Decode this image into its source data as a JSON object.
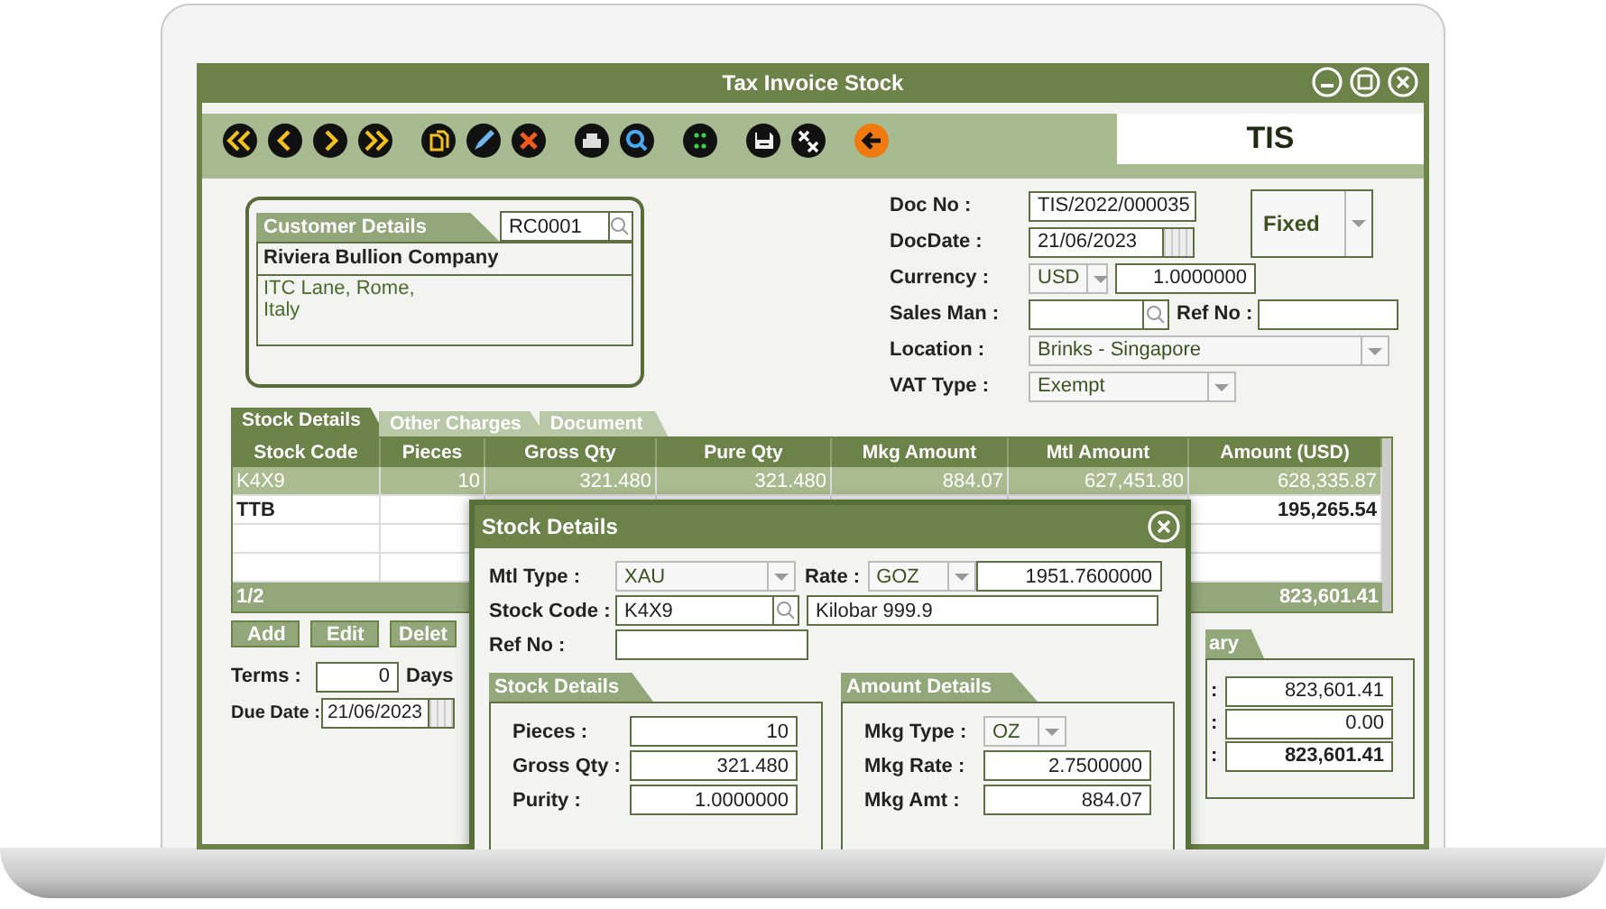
{
  "window": {
    "title": "Tax Invoice Stock"
  },
  "toolbar": {
    "code": "TIS"
  },
  "customer": {
    "label": "Customer Details",
    "code": "RC0001",
    "name": "Riviera Bullion Company",
    "address_lines": [
      "ITC Lane, Rome,",
      "Italy"
    ]
  },
  "doc": {
    "doc_no_label": "Doc No :",
    "doc_no": "TIS/2022/000035",
    "date_label": "DocDate :",
    "date": "21/06/2023",
    "rate_mode": "Fixed",
    "currency_label": "Currency :",
    "currency": "USD",
    "exchange_rate": "1.0000000",
    "salesman_label": "Sales Man :",
    "ref_no_label": "Ref No :",
    "location_label": "Location :",
    "location": "Brinks - Singapore",
    "vat_label": "VAT Type :",
    "vat_type": "Exempt"
  },
  "tabs": [
    {
      "label": "Stock Details",
      "selected": true
    },
    {
      "label": "Other Charges",
      "selected": false
    },
    {
      "label": "Document",
      "selected": false
    }
  ],
  "table": {
    "columns": [
      "Stock Code",
      "Pieces",
      "Gross Qty",
      "Pure Qty",
      "Mkg Amount",
      "Mtl Amount",
      "Amount (USD)"
    ],
    "rows": [
      {
        "kind": "line",
        "selected": true,
        "cells": [
          "K4X9",
          "10",
          "321.480",
          "321.480",
          "884.07",
          "627,451.80",
          "628,335.87"
        ]
      },
      {
        "kind": "subtotal",
        "selected": false,
        "code": "TTB",
        "amount": "195,265.54"
      }
    ],
    "footer": {
      "page": "1/2",
      "total": "823,601.41"
    }
  },
  "row_buttons": [
    "Add",
    "Edit",
    "Delet"
  ],
  "terms": {
    "label": "Terms :",
    "value": "0",
    "unit": "Days"
  },
  "due_date": {
    "label": "Due Date :",
    "value": "21/06/2023"
  },
  "summary": {
    "tab": "ary",
    "rows": [
      {
        "label": ":",
        "value": "823,601.41",
        "bold": false
      },
      {
        "label": ":",
        "value": "0.00",
        "bold": false
      },
      {
        "label": ":",
        "value": "823,601.41",
        "bold": true
      }
    ]
  },
  "dialog": {
    "title": "Stock Details",
    "mtl_type_label": "Mtl Type :",
    "mtl_type": "XAU",
    "rate_label": "Rate :",
    "rate_unit": "GOZ",
    "rate": "1951.7600000",
    "stock_code_label": "Stock Code :",
    "stock_code": "K4X9",
    "description": "Kilobar 999.9",
    "ref_no_label": "Ref No :",
    "stock_panel": {
      "title": "Stock Details",
      "fields": [
        {
          "label": "Pieces :",
          "value": "10"
        },
        {
          "label": "Gross Qty :",
          "value": "321.480"
        },
        {
          "label": "Purity :",
          "value": "1.0000000"
        }
      ]
    },
    "amount_panel": {
      "title": "Amount Details",
      "fields": [
        {
          "kind": "dropdown",
          "label": "Mkg Type :",
          "value": "OZ"
        },
        {
          "kind": "text",
          "label": "Mkg Rate :",
          "value": "2.7500000"
        },
        {
          "kind": "text",
          "label": "Mkg Amt :",
          "value": "884.07"
        }
      ]
    }
  }
}
